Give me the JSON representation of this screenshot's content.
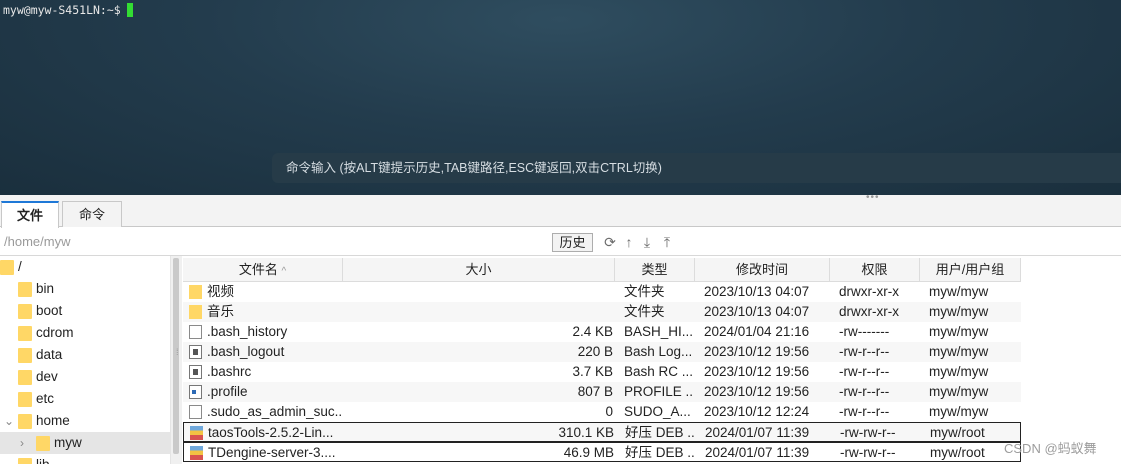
{
  "terminal": {
    "prompt": "myw@myw-S451LN:~$",
    "command_hint": "命令输入 (按ALT键提示历史,TAB键路径,ESC键返回,双击CTRL切换)"
  },
  "tabs": [
    {
      "label": "文件",
      "active": true
    },
    {
      "label": "命令",
      "active": false
    }
  ],
  "pathbar": {
    "path": "/home/myw",
    "history_label": "历史"
  },
  "tree": [
    {
      "label": "/",
      "level": 0,
      "expanded": true
    },
    {
      "label": "bin",
      "level": 1
    },
    {
      "label": "boot",
      "level": 1
    },
    {
      "label": "cdrom",
      "level": 1
    },
    {
      "label": "data",
      "level": 1
    },
    {
      "label": "dev",
      "level": 1
    },
    {
      "label": "etc",
      "level": 1
    },
    {
      "label": "home",
      "level": 1,
      "expanded": true
    },
    {
      "label": "myw",
      "level": 2,
      "selected": true
    },
    {
      "label": "lib",
      "level": 1
    }
  ],
  "columns": {
    "name": "文件名",
    "size": "大小",
    "type": "类型",
    "modified": "修改时间",
    "perms": "权限",
    "owner": "用户/用户组"
  },
  "files": [
    {
      "name": "视频",
      "size": "",
      "type": "文件夹",
      "modified": "2023/10/13 04:07",
      "perms": "drwxr-xr-x",
      "owner": "myw/myw",
      "icon": "folder-icon"
    },
    {
      "name": "音乐",
      "size": "",
      "type": "文件夹",
      "modified": "2023/10/13 04:07",
      "perms": "drwxr-xr-x",
      "owner": "myw/myw",
      "icon": "folder-icon"
    },
    {
      "name": ".bash_history",
      "size": "2.4 KB",
      "type": "BASH_HI...",
      "modified": "2024/01/04 21:16",
      "perms": "-rw-------",
      "owner": "myw/myw",
      "icon": "document-icon"
    },
    {
      "name": ".bash_logout",
      "size": "220 B",
      "type": "Bash Log...",
      "modified": "2023/10/12 19:56",
      "perms": "-rw-r--r--",
      "owner": "myw/myw",
      "icon": "script-icon"
    },
    {
      "name": ".bashrc",
      "size": "3.7 KB",
      "type": "Bash RC ...",
      "modified": "2023/10/12 19:56",
      "perms": "-rw-r--r--",
      "owner": "myw/myw",
      "icon": "script-icon"
    },
    {
      "name": ".profile",
      "size": "807 B",
      "type": "PROFILE ...",
      "modified": "2023/10/12 19:56",
      "perms": "-rw-r--r--",
      "owner": "myw/myw",
      "icon": "profile-icon"
    },
    {
      "name": ".sudo_as_admin_suc...",
      "size": "0",
      "type": "SUDO_A...",
      "modified": "2023/10/12 12:24",
      "perms": "-rw-r--r--",
      "owner": "myw/myw",
      "icon": "document-icon"
    },
    {
      "name": "taosTools-2.5.2-Lin...",
      "size": "310.1 KB",
      "type": "好压 DEB ...",
      "modified": "2024/01/07 11:39",
      "perms": "-rw-rw-r--",
      "owner": "myw/root",
      "icon": "package-icon"
    },
    {
      "name": "TDengine-server-3....",
      "size": "46.9 MB",
      "type": "好压 DEB ...",
      "modified": "2024/01/07 11:39",
      "perms": "-rw-rw-r--",
      "owner": "myw/root",
      "icon": "package-icon"
    }
  ],
  "watermark": "CSDN @蚂蚁舞"
}
